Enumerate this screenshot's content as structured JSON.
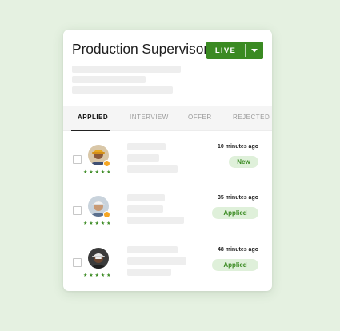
{
  "job": {
    "title": "Production Supervisor",
    "status_button": {
      "label": "LIVE",
      "caret_icon": "chevron-down-icon"
    }
  },
  "tabs": [
    {
      "label": "APPLIED",
      "active": true
    },
    {
      "label": "INTERVIEW",
      "active": false
    },
    {
      "label": "OFFER",
      "active": false
    },
    {
      "label": "REJECTED",
      "active": false
    }
  ],
  "candidates": [
    {
      "rating_stars": "★★★★★",
      "rating": 5,
      "time": "10 minutes ago",
      "status": "New"
    },
    {
      "rating_stars": "★★★★★",
      "rating": 5,
      "time": "35 minutes ago",
      "status": "Applied"
    },
    {
      "rating_stars": "★★★★★",
      "rating": 5,
      "time": "48 minutes ago",
      "status": "Applied"
    }
  ],
  "colors": {
    "background": "#e5f1e1",
    "accent": "#3a8a22",
    "status_pill_bg": "#dff0da",
    "badge": "#f5a623"
  }
}
